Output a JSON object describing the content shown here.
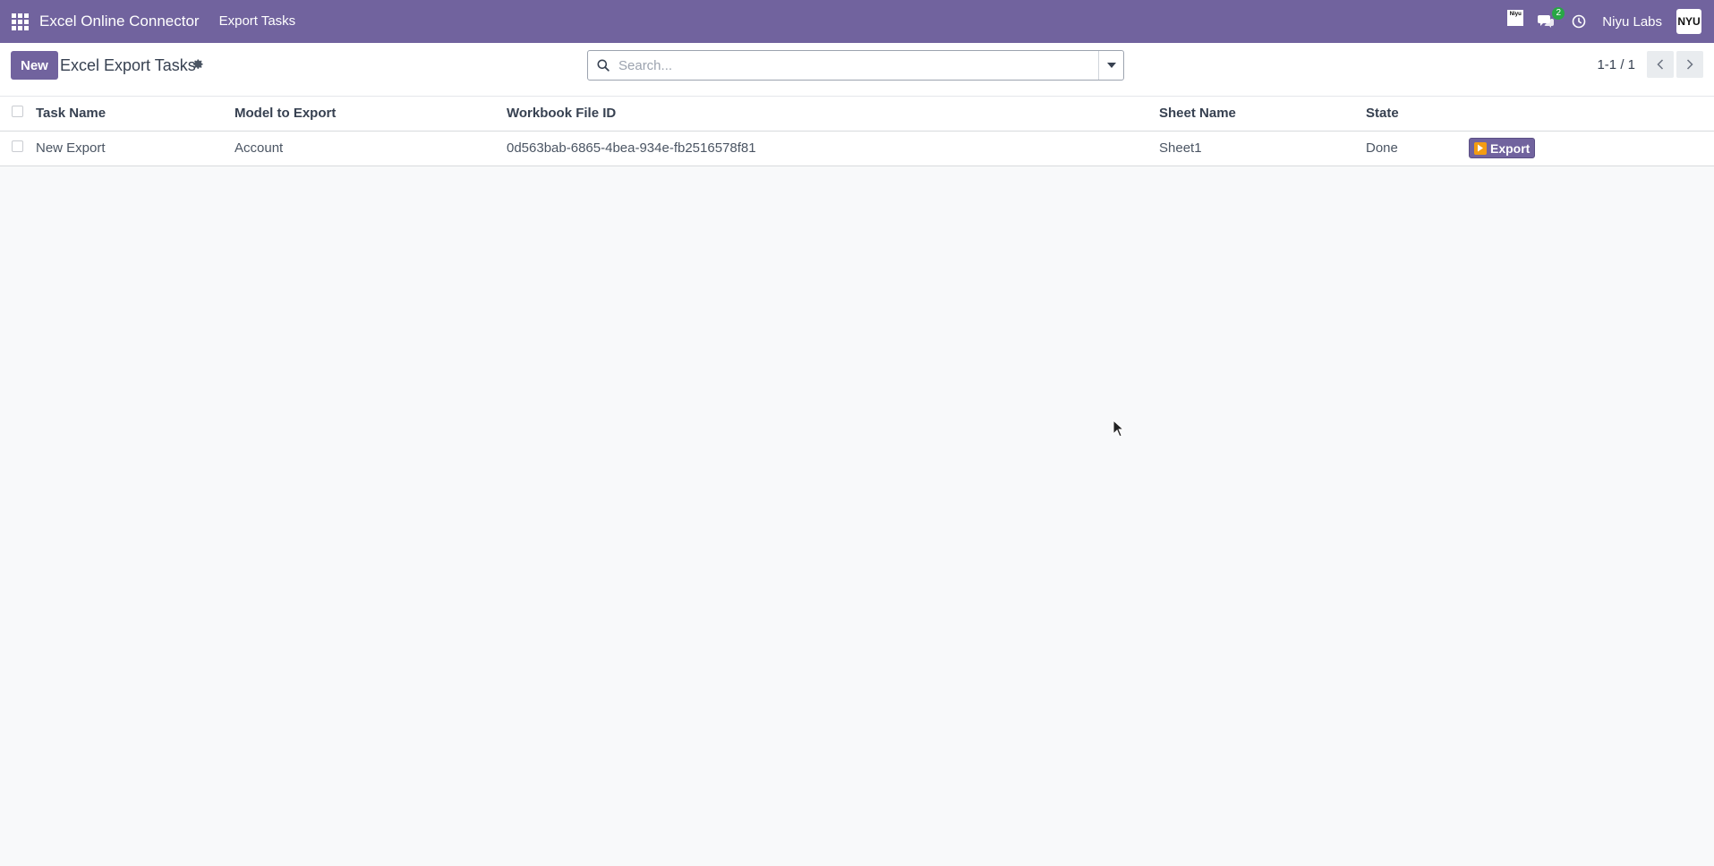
{
  "navbar": {
    "app_title": "Excel Online Connector",
    "menu_items": [
      "Export Tasks"
    ],
    "company_logo_text": "Niyu",
    "chat_count": "2",
    "user_name": "Niyu Labs",
    "avatar_text": "NYU"
  },
  "control_panel": {
    "new_label": "New",
    "title": "Excel Export Tasks",
    "search_placeholder": "Search...",
    "pager": "1-1 / 1"
  },
  "table": {
    "columns": [
      "Task Name",
      "Model to Export",
      "Workbook File ID",
      "Sheet Name",
      "State"
    ],
    "rows": [
      {
        "task_name": "New Export",
        "model": "Account",
        "workbook_file_id": "0d563bab-6865-4bea-934e-fb2516578f81",
        "sheet_name": "Sheet1",
        "state": "Done",
        "action_label": "Export"
      }
    ]
  },
  "colors": {
    "brand": "#71639e",
    "accent_orange": "#f39c12",
    "badge_green": "#28a745"
  }
}
